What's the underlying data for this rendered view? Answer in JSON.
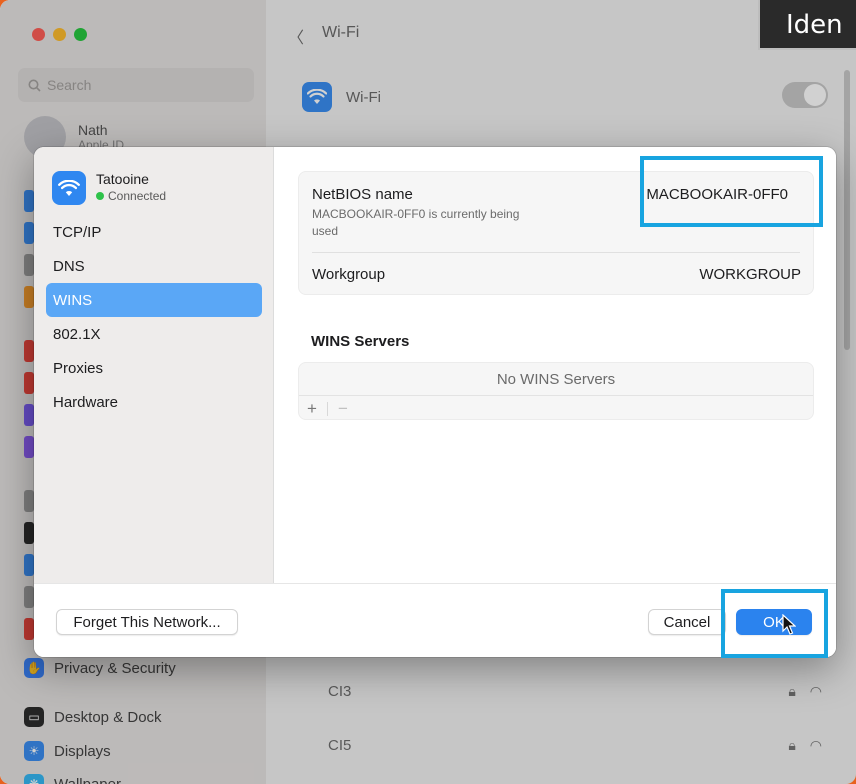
{
  "background_window": {
    "search_placeholder": "Search",
    "user_name": "Nath",
    "user_sub": "Apple ID",
    "sidebar_items": [
      {
        "label": "Privacy & Security",
        "icon": "hand-icon",
        "color": "#3b82f6"
      },
      {
        "label": "Desktop & Dock",
        "icon": "dock-icon",
        "color": "#2d2d2d"
      },
      {
        "label": "Displays",
        "icon": "sun-icon",
        "color": "#3b8df0"
      },
      {
        "label": "Wallpaper",
        "icon": "wallpaper-icon",
        "color": "#36b7f3"
      }
    ],
    "back_title": "Wi-Fi",
    "wifi_label": "Wi-Fi",
    "networks": [
      {
        "name": "CI3"
      },
      {
        "name": "CI5"
      }
    ]
  },
  "corner_label": "Iden",
  "sheet": {
    "network_name": "Tatooine",
    "network_status": "Connected",
    "nav": [
      {
        "label": "TCP/IP",
        "selected": false
      },
      {
        "label": "DNS",
        "selected": false
      },
      {
        "label": "WINS",
        "selected": true
      },
      {
        "label": "802.1X",
        "selected": false
      },
      {
        "label": "Proxies",
        "selected": false
      },
      {
        "label": "Hardware",
        "selected": false
      }
    ],
    "netbios_label": "NetBIOS name",
    "netbios_value": "MACBOOKAIR-0FF0",
    "netbios_note": "MACBOOKAIR-0FF0 is currently being used",
    "workgroup_label": "Workgroup",
    "workgroup_value": "WORKGROUP",
    "wins_servers_title": "WINS Servers",
    "wins_servers_empty": "No WINS Servers",
    "add_label": "+",
    "remove_label": "−",
    "forget_button": "Forget This Network...",
    "cancel_button": "Cancel",
    "ok_button": "OK"
  },
  "colors": {
    "accent": "#2b83ee",
    "selected_nav": "#5aa7f6",
    "highlight_box": "#18a4e0",
    "connected_dot": "#2ec24a"
  }
}
